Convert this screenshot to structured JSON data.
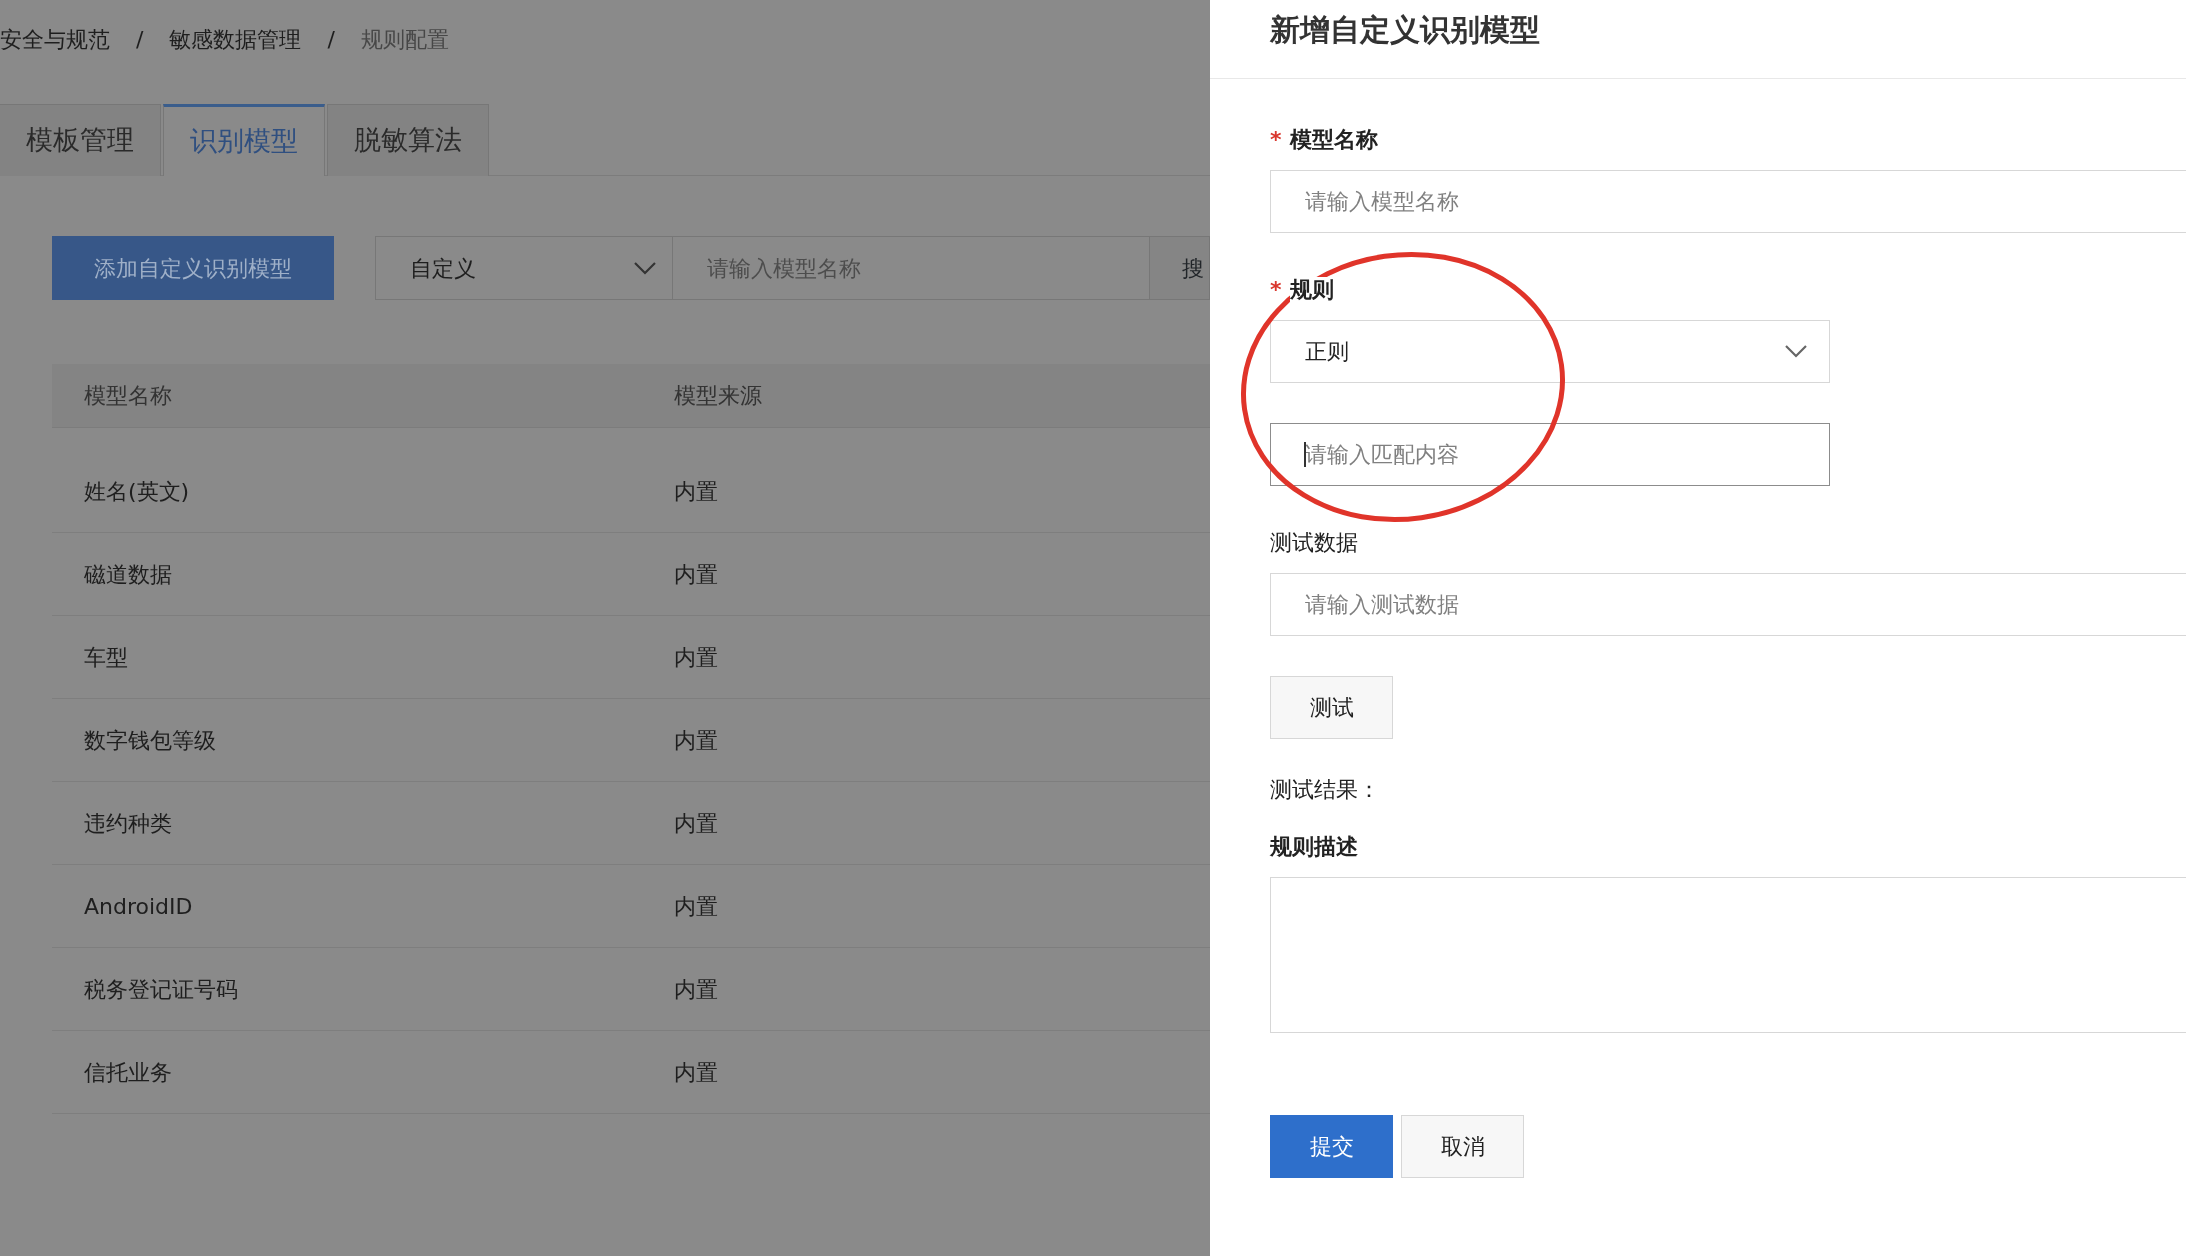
{
  "breadcrumb": [
    {
      "label": "安全与规范",
      "current": false
    },
    {
      "label": "敏感数据管理",
      "current": false
    },
    {
      "label": "规则配置",
      "current": true
    }
  ],
  "breadcrumb_separator": "/",
  "tabs": [
    {
      "label": "模板管理",
      "selected": false
    },
    {
      "label": "识别模型",
      "selected": true
    },
    {
      "label": "脱敏算法",
      "selected": false
    }
  ],
  "toolbar": {
    "add_button": "添加自定义识别模型",
    "filter": {
      "value": "自定义"
    },
    "search": {
      "placeholder": "请输入模型名称"
    },
    "search_button": "搜"
  },
  "table": {
    "columns": [
      "模型名称",
      "模型来源"
    ],
    "rows": [
      [
        "姓名(英文)",
        "内置"
      ],
      [
        "磁道数据",
        "内置"
      ],
      [
        "车型",
        "内置"
      ],
      [
        "数字钱包等级",
        "内置"
      ],
      [
        "违约种类",
        "内置"
      ],
      [
        "AndroidID",
        "内置"
      ],
      [
        "税务登记证号码",
        "内置"
      ],
      [
        "信托业务",
        "内置"
      ]
    ]
  },
  "drawer": {
    "title": "新增自定义识别模型",
    "items": [
      {
        "kind": "input",
        "label": "模型名称",
        "required": true,
        "label_bold": true,
        "placeholder": "请输入模型名称"
      },
      {
        "kind": "select",
        "label": "规则",
        "required": true,
        "label_bold": true,
        "value": "正则"
      },
      {
        "kind": "input",
        "placeholder": "请输入匹配内容",
        "focused": true
      },
      {
        "kind": "input",
        "label": "测试数据",
        "required": false,
        "label_bold": false,
        "placeholder": "请输入测试数据"
      },
      {
        "kind": "button",
        "label": "测试"
      },
      {
        "kind": "text",
        "label": "测试结果："
      },
      {
        "kind": "textarea",
        "label": "规则描述",
        "required": false,
        "label_bold": true
      }
    ],
    "actions": [
      {
        "label": "提交",
        "kind": "primary"
      },
      {
        "label": "取消",
        "kind": "default"
      }
    ],
    "required_mark": "*"
  }
}
